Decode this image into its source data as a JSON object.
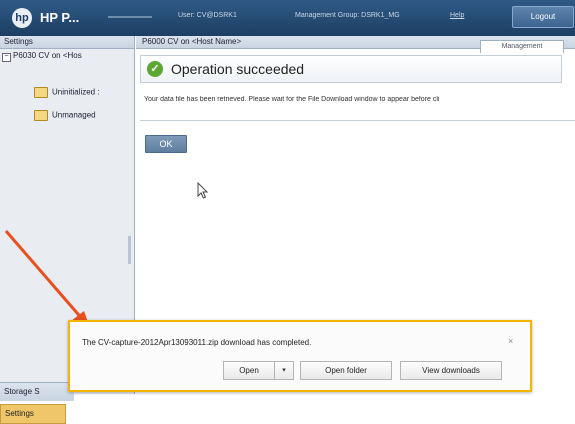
{
  "header": {
    "app_title": "HP P...",
    "user_info": "User: CV@DSRK1",
    "management_group": "Management Group: DSRK1_MG",
    "help": "Help",
    "logout": "Logout"
  },
  "sidebar": {
    "title": "Settings",
    "root_item": "P6030 CV on <Hos",
    "items": [
      {
        "label": "Uninitialized :"
      },
      {
        "label": "Unmanaged"
      }
    ],
    "storage_tab": "Storage S",
    "settings_tab": "Settings"
  },
  "main": {
    "title": "P6000 CV on <Host Name>",
    "tab": "Management",
    "operation_status": "Operation succeeded",
    "info_message": "Your data file has been retrieved. Please wait for the File Download window to appear before cli",
    "ok_button": "OK"
  },
  "download_bar": {
    "message": "The CV-capture-2012Apr13093011.zip download has completed.",
    "open": "Open",
    "open_dropdown": "▾",
    "open_folder": "Open folder",
    "view_downloads": "View downloads",
    "close": "×"
  },
  "colors": {
    "header_bg": "#1d3f63",
    "download_bar_border": "#f5b400",
    "annotation_arrow": "#e8501e",
    "success_icon": "#5aa832"
  }
}
